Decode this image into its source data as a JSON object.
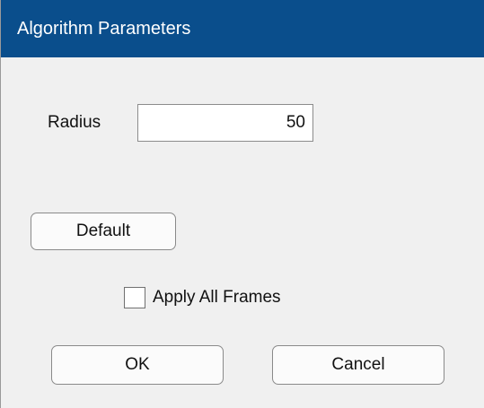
{
  "window": {
    "title": "Algorithm Parameters"
  },
  "form": {
    "radius_label": "Radius",
    "radius_value": "50",
    "default_button_label": "Default",
    "apply_all_frames_label": "Apply All Frames",
    "apply_all_frames_checked": false
  },
  "footer": {
    "ok_label": "OK",
    "cancel_label": "Cancel"
  },
  "colors": {
    "titlebar_background": "#0a4e8c",
    "title_text": "#ffffff",
    "dialog_background": "#f0f0f0"
  }
}
